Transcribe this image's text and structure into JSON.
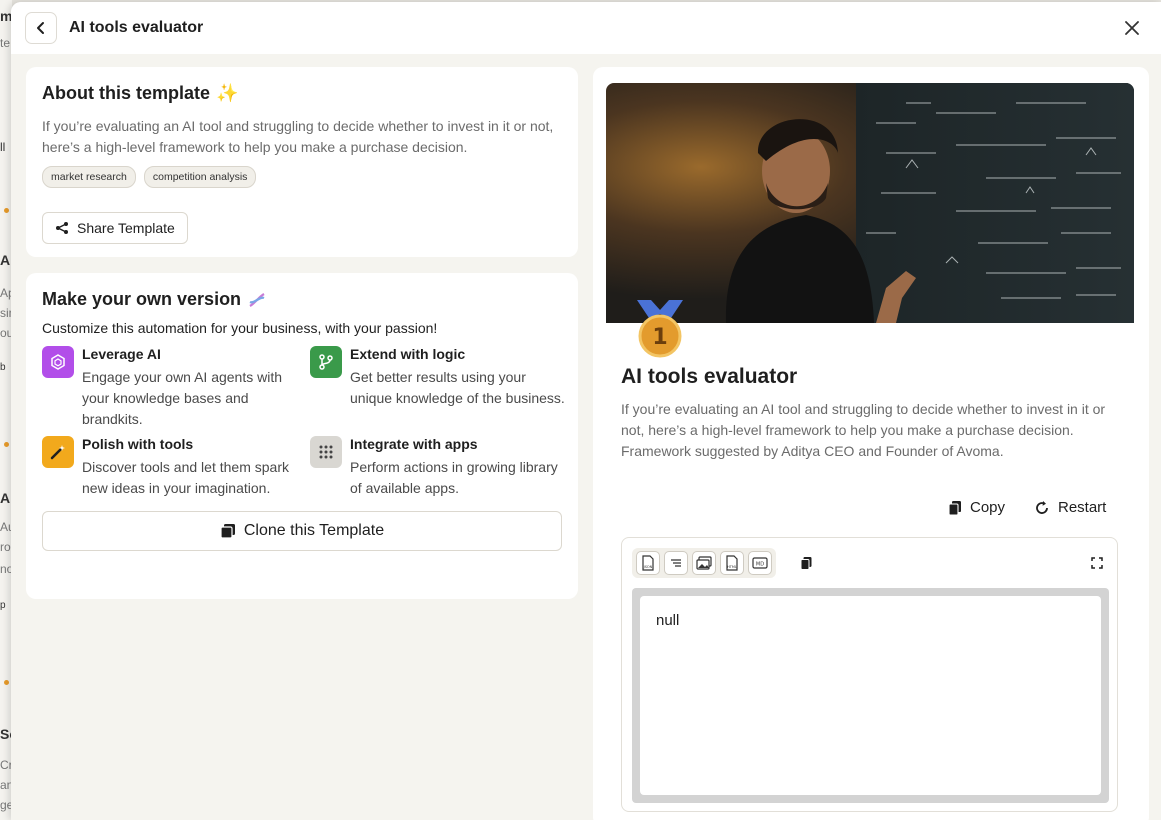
{
  "header": {
    "title": "AI tools evaluator"
  },
  "about": {
    "heading": "About this template",
    "heading_emoji": "✨",
    "description": "If you’re evaluating an AI tool and struggling to decide whether to invest in it or not, here’s a high-level framework to help you make a purchase decision.",
    "tags": [
      "market research",
      "competition analysis"
    ],
    "share_label": "Share Template"
  },
  "make_own": {
    "heading": "Make your own version",
    "subtitle": "Customize this automation for your business, with your passion!",
    "features": [
      {
        "title": "Leverage AI",
        "text": "Engage your own AI agents with your knowledge bases and brandkits.",
        "icon": "cube-ai-icon",
        "color": "#b24ee9"
      },
      {
        "title": "Extend with logic",
        "text": "Get better results using your unique knowledge of the business.",
        "icon": "branch-icon",
        "color": "#3a9a4a"
      },
      {
        "title": "Polish with tools",
        "text": "Discover tools and let them spark new ideas in your imagination.",
        "icon": "magic-wand-icon",
        "color": "#f2a91c"
      },
      {
        "title": "Integrate with apps",
        "text": "Perform actions in growing library of available apps.",
        "icon": "apps-grid-icon",
        "color": "#d9d7d2"
      }
    ],
    "clone_label": "Clone this Template"
  },
  "preview": {
    "rank": "1",
    "title": "AI tools evaluator",
    "description": "If you’re evaluating an AI tool and struggling to decide whether to invest in it or not, here’s a high-level framework to help you make a purchase decision. Framework suggested by Aditya CEO and Founder of Avoma.",
    "copy_label": "Copy",
    "restart_label": "Restart",
    "toolbar": [
      "JSON",
      "TXT",
      "IMG",
      "HTML",
      "MD"
    ],
    "output": "null"
  },
  "background": {
    "letters": [
      "m",
      "te",
      "ll",
      "Ap",
      "Ap",
      "sin",
      "ou",
      "b",
      "AI",
      "Au",
      "ro",
      "no",
      "p",
      "So",
      "Cr",
      "an",
      "ge"
    ]
  }
}
